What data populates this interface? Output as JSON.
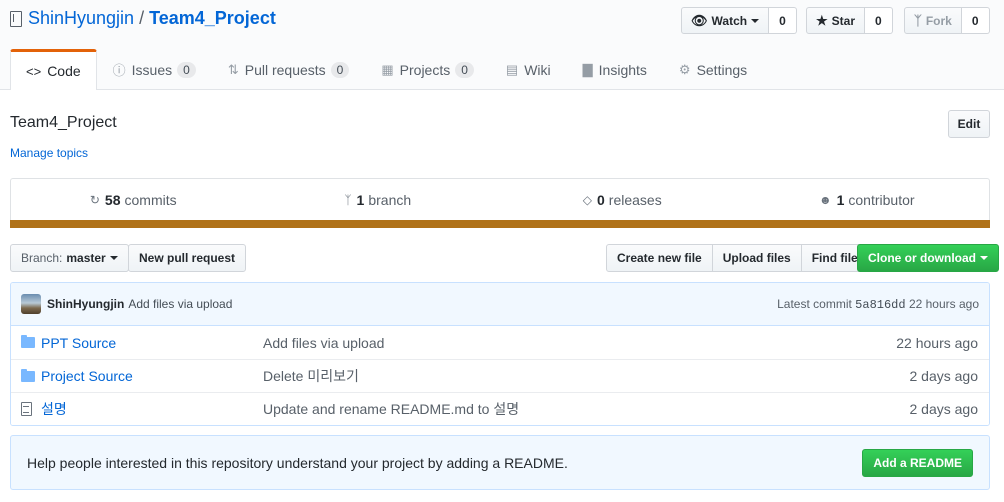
{
  "repo": {
    "owner": "ShinHyungjin",
    "separator": "/",
    "name": "Team4_Project"
  },
  "social": {
    "watch_label": "Watch",
    "watch_count": "0",
    "star_label": "Star",
    "star_count": "0",
    "fork_label": "Fork",
    "fork_count": "0"
  },
  "tabs": [
    {
      "label": "Code",
      "icon": "code-icon"
    },
    {
      "label": "Issues",
      "count": "0",
      "icon": "issue-icon"
    },
    {
      "label": "Pull requests",
      "count": "0",
      "icon": "pull-request-icon"
    },
    {
      "label": "Projects",
      "count": "0",
      "icon": "project-icon"
    },
    {
      "label": "Wiki",
      "icon": "book-icon"
    },
    {
      "label": "Insights",
      "icon": "graph-icon"
    },
    {
      "label": "Settings",
      "icon": "gear-icon"
    }
  ],
  "description": "Team4_Project",
  "manage_topics": "Manage topics",
  "edit_label": "Edit",
  "summary": {
    "commits_num": "58",
    "commits_label": "commits",
    "branch_num": "1",
    "branch_label": "branch",
    "releases_num": "0",
    "releases_label": "releases",
    "contributors_num": "1",
    "contributors_label": "contributor"
  },
  "language_color": "#b07219",
  "toolbar": {
    "branch_prefix": "Branch:",
    "branch_name": "master",
    "new_pr": "New pull request",
    "create_file": "Create new file",
    "upload_files": "Upload files",
    "find_file": "Find file",
    "clone": "Clone or download"
  },
  "commit": {
    "author": "ShinHyungjin",
    "message": "Add files via upload",
    "latest_label": "Latest commit",
    "sha": "5a816dd",
    "age": "22 hours ago"
  },
  "files": [
    {
      "type": "folder",
      "name": "PPT Source",
      "message": "Add files via upload",
      "age": "22 hours ago"
    },
    {
      "type": "folder",
      "name": "Project Source",
      "message": "Delete 미리보기",
      "age": "2 days ago"
    },
    {
      "type": "file",
      "name": "설명",
      "message": "Update and rename README.md to 설명",
      "age": "2 days ago"
    }
  ],
  "readme_prompt": {
    "text": "Help people interested in this repository understand your project by adding a README.",
    "button": "Add a README"
  }
}
